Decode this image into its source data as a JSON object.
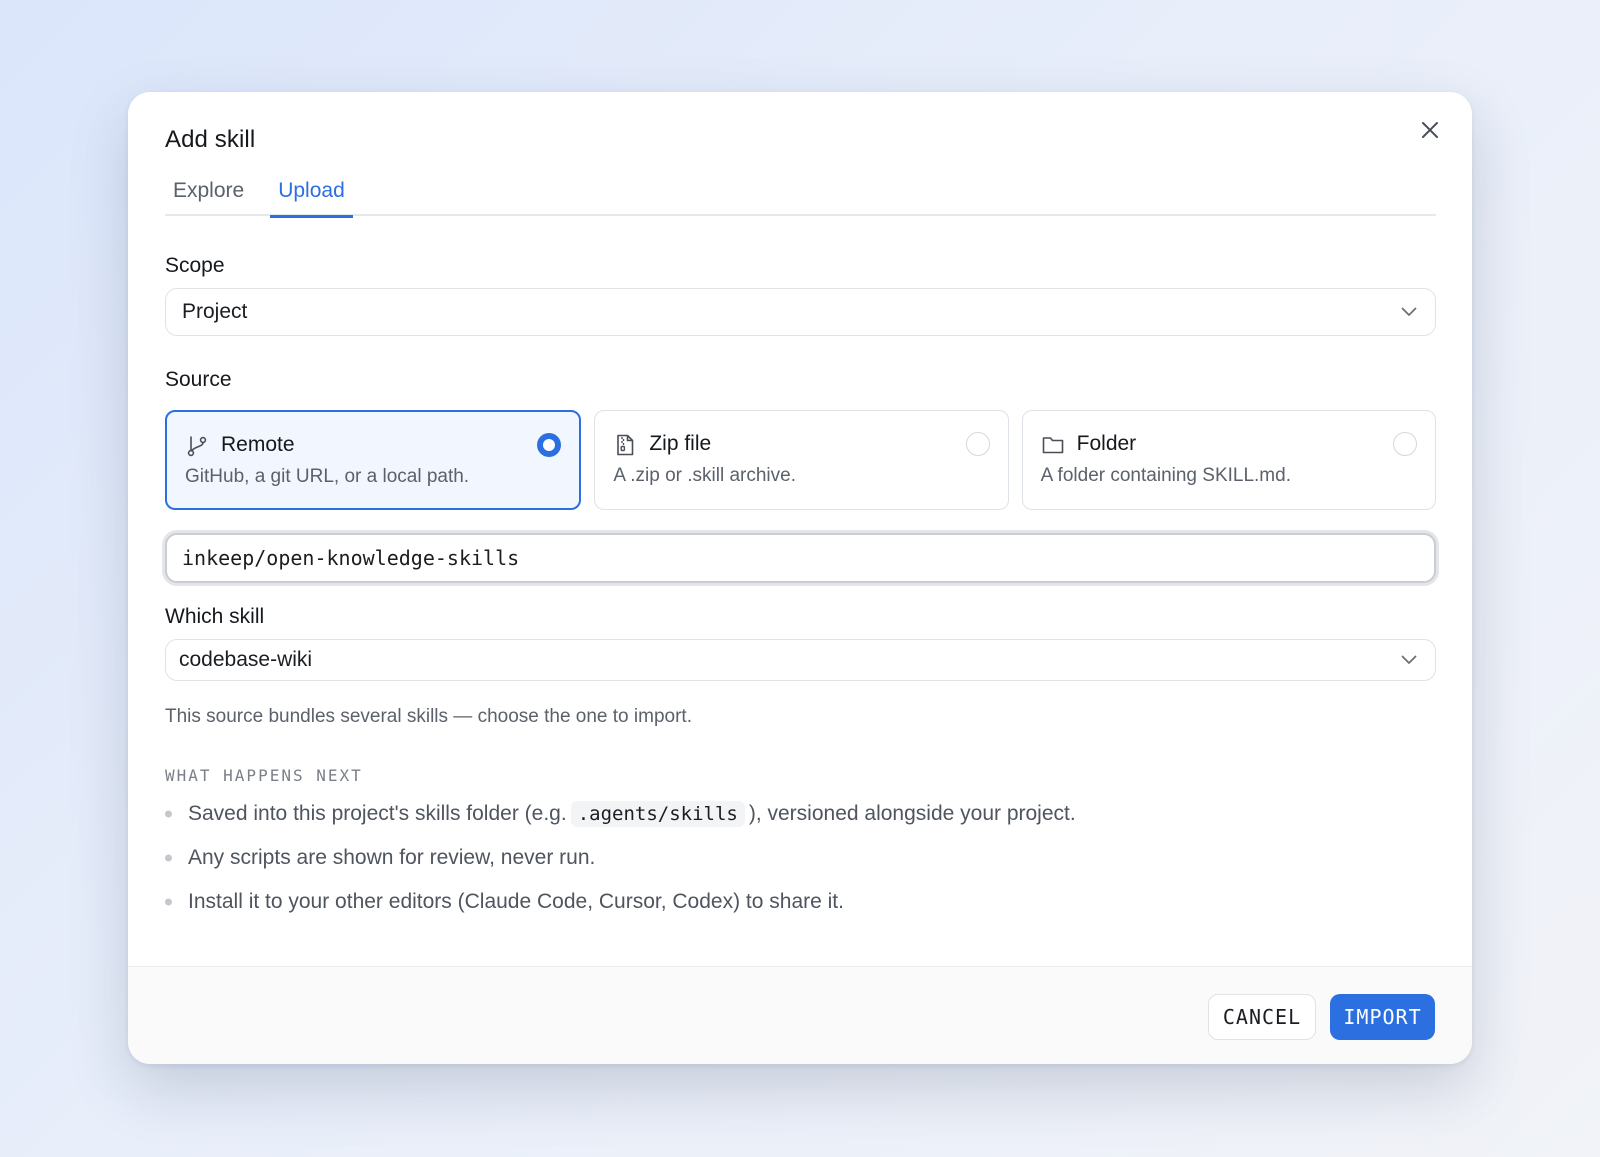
{
  "dialog": {
    "title": "Add skill",
    "close_icon": "close-icon"
  },
  "tabs": [
    {
      "label": "Explore",
      "active": false
    },
    {
      "label": "Upload",
      "active": true
    }
  ],
  "scope": {
    "label": "Scope",
    "value": "Project"
  },
  "source": {
    "label": "Source",
    "options": [
      {
        "name": "Remote",
        "description": "GitHub, a git URL, or a local path.",
        "icon": "git-branch-icon",
        "selected": true
      },
      {
        "name": "Zip file",
        "description": "A .zip or .skill archive.",
        "icon": "zip-file-icon",
        "selected": false
      },
      {
        "name": "Folder",
        "description": "A folder containing SKILL.md.",
        "icon": "folder-icon",
        "selected": false
      }
    ],
    "input_value": "inkeep/open-knowledge-skills"
  },
  "which_skill": {
    "label": "Which skill",
    "value": "codebase-wiki",
    "hint": "This source bundles several skills — choose the one to import."
  },
  "next": {
    "title": "WHAT HAPPENS NEXT",
    "bullet1_before": "Saved into this project's skills folder (e.g.",
    "bullet1_code": ".agents/skills",
    "bullet1_after": "), versioned alongside your project.",
    "bullet2": "Any scripts are shown for review, never run.",
    "bullet3": "Install it to your other editors (Claude Code, Cursor, Codex) to share it."
  },
  "footer": {
    "cancel_label": "CANCEL",
    "import_label": "IMPORT"
  },
  "colors": {
    "accent": "#2b6fe0",
    "selected_bg": "#f2f7ff",
    "muted_text": "#5b616b"
  }
}
